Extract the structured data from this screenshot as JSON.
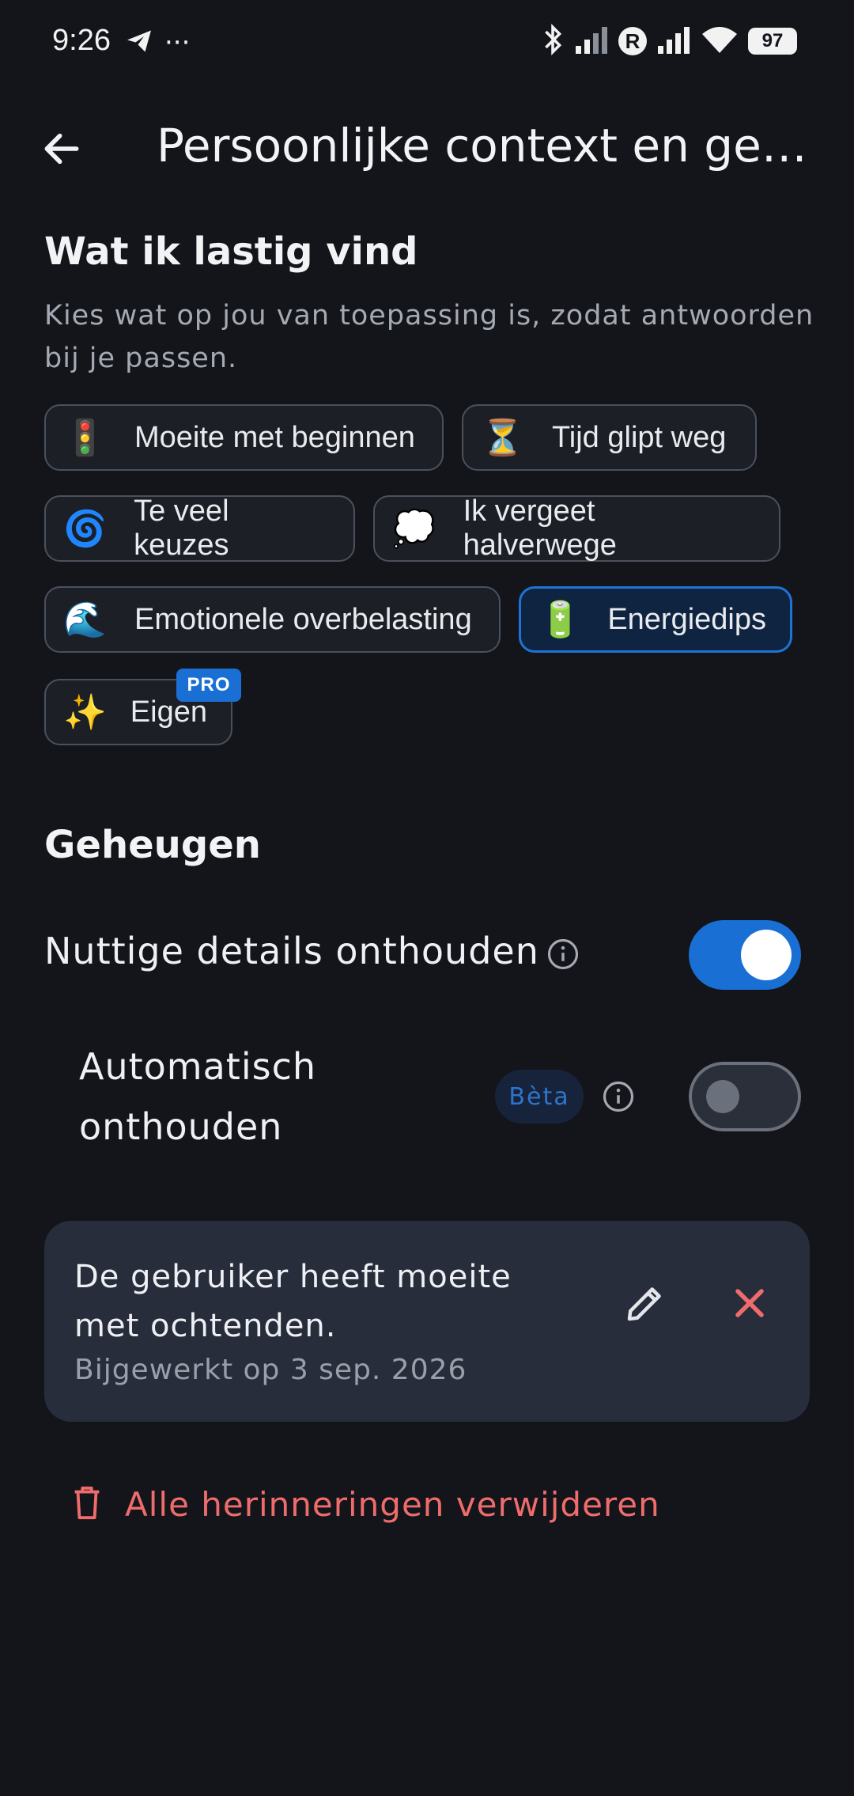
{
  "status_bar": {
    "time": "9:26",
    "more": "···",
    "roaming": "R",
    "battery": "97",
    "icons": [
      "telegram-icon",
      "bluetooth-icon",
      "signal-icon",
      "signal-icon",
      "wifi-icon",
      "battery-icon"
    ]
  },
  "header": {
    "title": "Persoonlijke context en geheugen"
  },
  "difficulties": {
    "title": "Wat ik lastig vind",
    "description": "Kies wat op jou van toepassing is, zodat antwoorden bij je passen.",
    "chips": [
      {
        "emoji": "🚦",
        "label": "Moeite met beginnen",
        "selected": false
      },
      {
        "emoji": "⏳",
        "label": "Tijd glipt weg",
        "selected": false
      },
      {
        "emoji": "🌀",
        "label": "Te veel keuzes",
        "selected": false
      },
      {
        "emoji": "💭",
        "label": "Ik vergeet halverwege",
        "selected": false
      },
      {
        "emoji": "🌊",
        "label": "Emotionele overbelasting",
        "selected": false
      },
      {
        "emoji": "🔋",
        "label": "Energiedips",
        "selected": true
      },
      {
        "emoji": "✨",
        "label": "Eigen",
        "selected": false,
        "badge": "PRO"
      }
    ]
  },
  "memory": {
    "title": "Geheugen",
    "remember_details": {
      "label": "Nuttige details onthouden",
      "enabled": true
    },
    "auto_remember": {
      "label": "Automatisch onthouden",
      "badge": "Bèta",
      "enabled": false
    },
    "items": [
      {
        "text": "De gebruiker heeft moeite met ochtenden.",
        "updated": "Bijgewerkt op 3 sep. 2026"
      }
    ],
    "delete_all_label": "Alle herinneringen verwijderen"
  },
  "colors": {
    "background": "#13151a",
    "accent": "#1a6fd4",
    "danger": "#ef6c6c",
    "card": "#272d3b"
  }
}
